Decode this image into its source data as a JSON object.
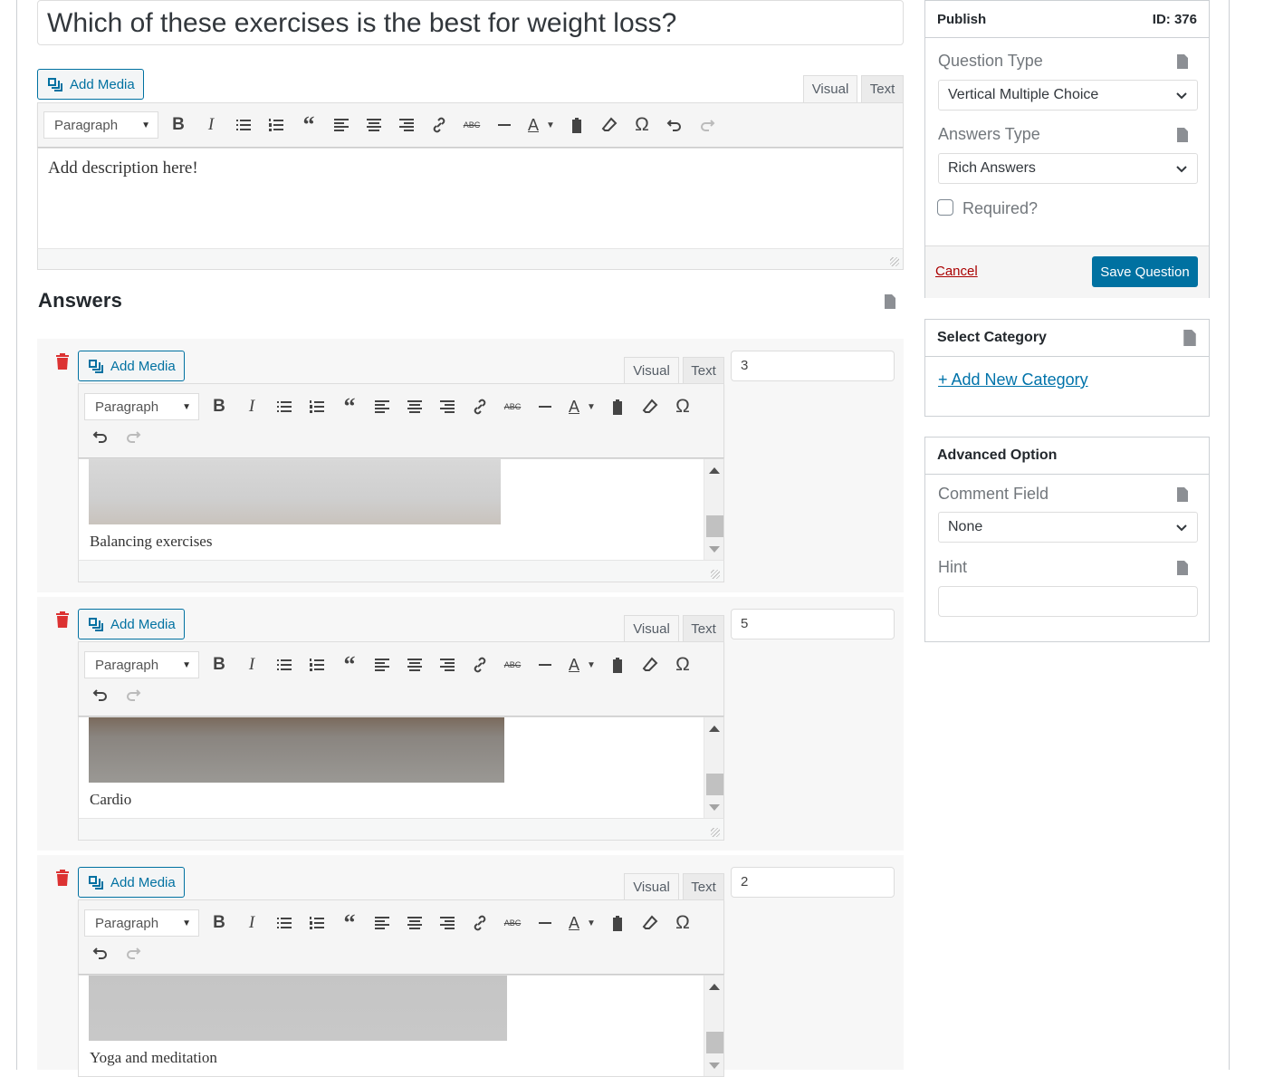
{
  "question": {
    "title": "Which of these exercises is the best for weight loss?",
    "description": "Add description here!"
  },
  "editor": {
    "add_media": "Add Media",
    "tab_visual": "Visual",
    "tab_text": "Text",
    "format": "Paragraph"
  },
  "answers_heading": "Answers",
  "answers": [
    {
      "caption": "Balancing exercises",
      "points": "3"
    },
    {
      "caption": "Cardio",
      "points": "5"
    },
    {
      "caption": "Yoga and meditation",
      "points": "2"
    }
  ],
  "publish": {
    "title": "Publish",
    "id_label": "ID: 376",
    "question_type_label": "Question Type",
    "question_type_value": "Vertical Multiple Choice",
    "answers_type_label": "Answers Type",
    "answers_type_value": "Rich Answers",
    "required_label": "Required?",
    "cancel": "Cancel",
    "save": "Save Question"
  },
  "category": {
    "title": "Select Category",
    "add_new": "+ Add New Category"
  },
  "advanced": {
    "title": "Advanced Option",
    "comment_label": "Comment Field",
    "comment_value": "None",
    "hint_label": "Hint"
  },
  "colors": {
    "accent": "#0071a1",
    "danger": "#a00",
    "trash": "#dc3232"
  }
}
